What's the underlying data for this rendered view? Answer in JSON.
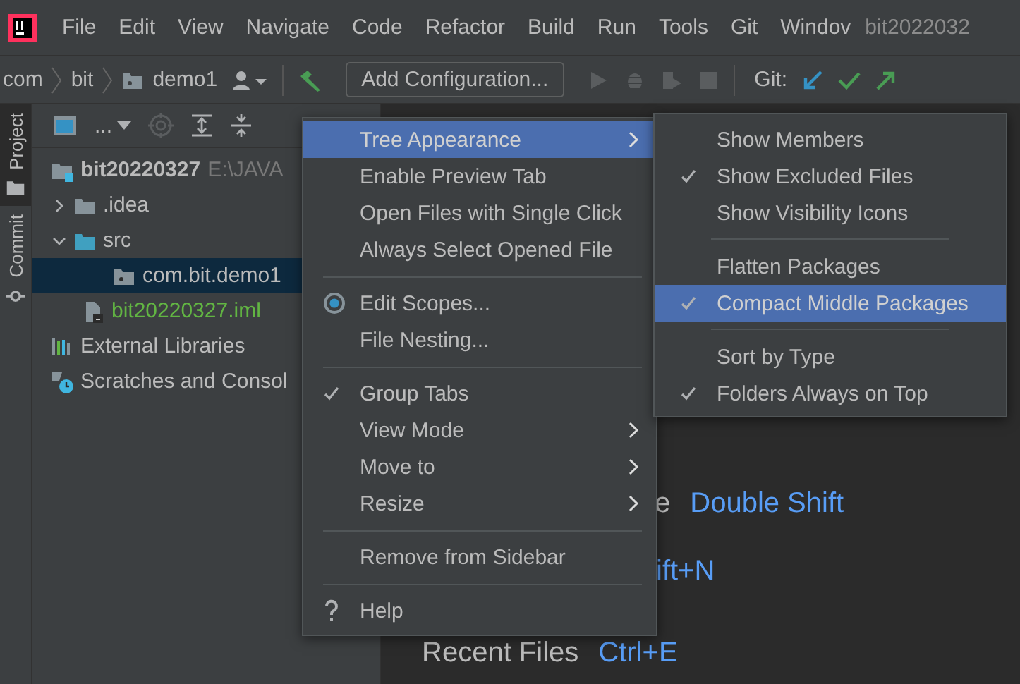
{
  "menubar": {
    "items": [
      {
        "label": "File"
      },
      {
        "label": "Edit"
      },
      {
        "label": "View"
      },
      {
        "label": "Navigate"
      },
      {
        "label": "Code"
      },
      {
        "label": "Refactor"
      },
      {
        "label": "Build"
      },
      {
        "label": "Run"
      },
      {
        "label": "Tools"
      },
      {
        "label": "Git"
      },
      {
        "label": "Windov"
      }
    ],
    "title": "bit2022032"
  },
  "breadcrumb": [
    "com",
    "bit",
    "demo1"
  ],
  "toolbar": {
    "config_button": "Add Configuration...",
    "git_label": "Git:"
  },
  "side_tabs": [
    {
      "label": "Project",
      "kind": "project",
      "selected": true
    },
    {
      "label": "Commit",
      "kind": "commit",
      "selected": false
    }
  ],
  "project_panel": {
    "view_label": "...",
    "tree": [
      {
        "name": "bit20220327",
        "path": "E:\\JAVA",
        "kind": "module",
        "selected": false,
        "children": [
          {
            "name": ".idea",
            "kind": "folder",
            "selected": false,
            "expanded": false
          },
          {
            "name": "src",
            "kind": "source",
            "selected": false,
            "expanded": true,
            "children": [
              {
                "name": "com.bit.demo1",
                "kind": "package",
                "selected": true
              }
            ]
          },
          {
            "name": "bit20220327.iml",
            "kind": "iml",
            "selected": false
          }
        ]
      },
      {
        "name": "External Libraries",
        "kind": "libraries",
        "selected": false
      },
      {
        "name": "Scratches and Consol",
        "kind": "scratches",
        "selected": false
      }
    ]
  },
  "editor_hints": [
    {
      "label": "e",
      "shortcut": "Double Shift"
    },
    {
      "shortcut": "ift+N"
    },
    {
      "label": "Recent Files",
      "shortcut": "Ctrl+E"
    }
  ],
  "context_menu": [
    {
      "kind": "item",
      "label": "Tree Appearance",
      "selected": true,
      "checked": false,
      "submenu": true
    },
    {
      "kind": "item",
      "label": "Enable Preview Tab",
      "selected": false,
      "checked": false,
      "submenu": false
    },
    {
      "kind": "item",
      "label": "Open Files with Single Click",
      "selected": false,
      "checked": false,
      "submenu": false
    },
    {
      "kind": "item",
      "label": "Always Select Opened File",
      "selected": false,
      "checked": false,
      "submenu": false
    },
    {
      "kind": "separator"
    },
    {
      "kind": "radio",
      "label": "Edit Scopes...",
      "selected": false,
      "checked": true,
      "submenu": false
    },
    {
      "kind": "item",
      "label": "File Nesting...",
      "selected": false,
      "checked": false,
      "submenu": false
    },
    {
      "kind": "separator"
    },
    {
      "kind": "item",
      "label": "Group Tabs",
      "selected": false,
      "checked": true,
      "submenu": false
    },
    {
      "kind": "item",
      "label": "View Mode",
      "selected": false,
      "checked": false,
      "submenu": true
    },
    {
      "kind": "item",
      "label": "Move to",
      "selected": false,
      "checked": false,
      "submenu": true
    },
    {
      "kind": "item",
      "label": "Resize",
      "selected": false,
      "checked": false,
      "submenu": true
    },
    {
      "kind": "separator"
    },
    {
      "kind": "item",
      "label": "Remove from Sidebar",
      "selected": false,
      "checked": false,
      "submenu": false
    },
    {
      "kind": "separator"
    },
    {
      "kind": "help",
      "label": "Help",
      "selected": false,
      "submenu": false
    }
  ],
  "submenu": [
    {
      "kind": "item",
      "label": "Show Members",
      "selected": false,
      "checked": false
    },
    {
      "kind": "item",
      "label": "Show Excluded Files",
      "selected": false,
      "checked": true
    },
    {
      "kind": "item",
      "label": "Show Visibility Icons",
      "selected": false,
      "checked": false
    },
    {
      "kind": "separator"
    },
    {
      "kind": "item",
      "label": "Flatten Packages",
      "selected": false,
      "checked": false
    },
    {
      "kind": "item",
      "label": "Compact Middle Packages",
      "selected": true,
      "checked": true
    },
    {
      "kind": "separator"
    },
    {
      "kind": "item",
      "label": "Sort by Type",
      "selected": false,
      "checked": false
    },
    {
      "kind": "item",
      "label": "Folders Always on Top",
      "selected": false,
      "checked": true
    }
  ]
}
